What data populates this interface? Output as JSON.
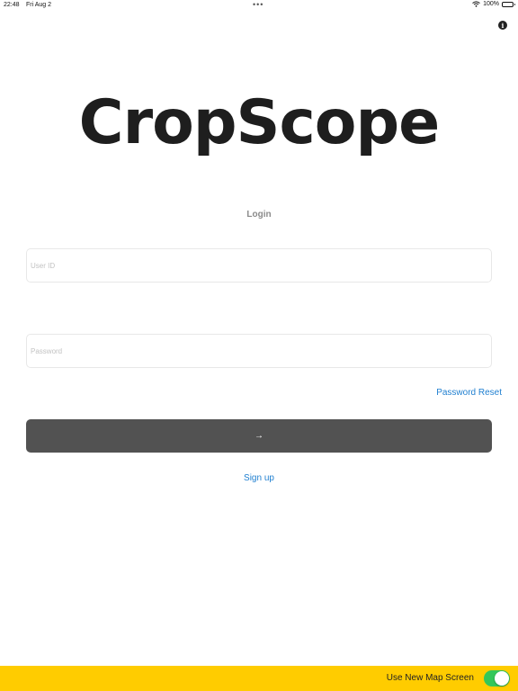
{
  "status_bar": {
    "time": "22:48",
    "date": "Fri Aug 2",
    "dots": "•••",
    "battery": "100%"
  },
  "icons": {
    "info": "info-icon",
    "wifi": "wifi-icon",
    "battery": "battery-icon",
    "submit": "arrow-right-icon"
  },
  "header": {
    "info_glyph": "i"
  },
  "logo": {
    "text": "CropScope"
  },
  "login": {
    "title": "Login",
    "userid_placeholder": "User ID",
    "userid_value": "",
    "password_placeholder": "Password",
    "password_value": "",
    "password_reset_label": "Password Reset",
    "submit_glyph": "→",
    "signup_label": "Sign up"
  },
  "bottom_bar": {
    "toggle_label": "Use New Map Screen",
    "toggle_on": true
  },
  "colors": {
    "link": "#1f7fd0",
    "button": "#525252",
    "bar": "#ffcc00",
    "toggle_on": "#34c759"
  }
}
